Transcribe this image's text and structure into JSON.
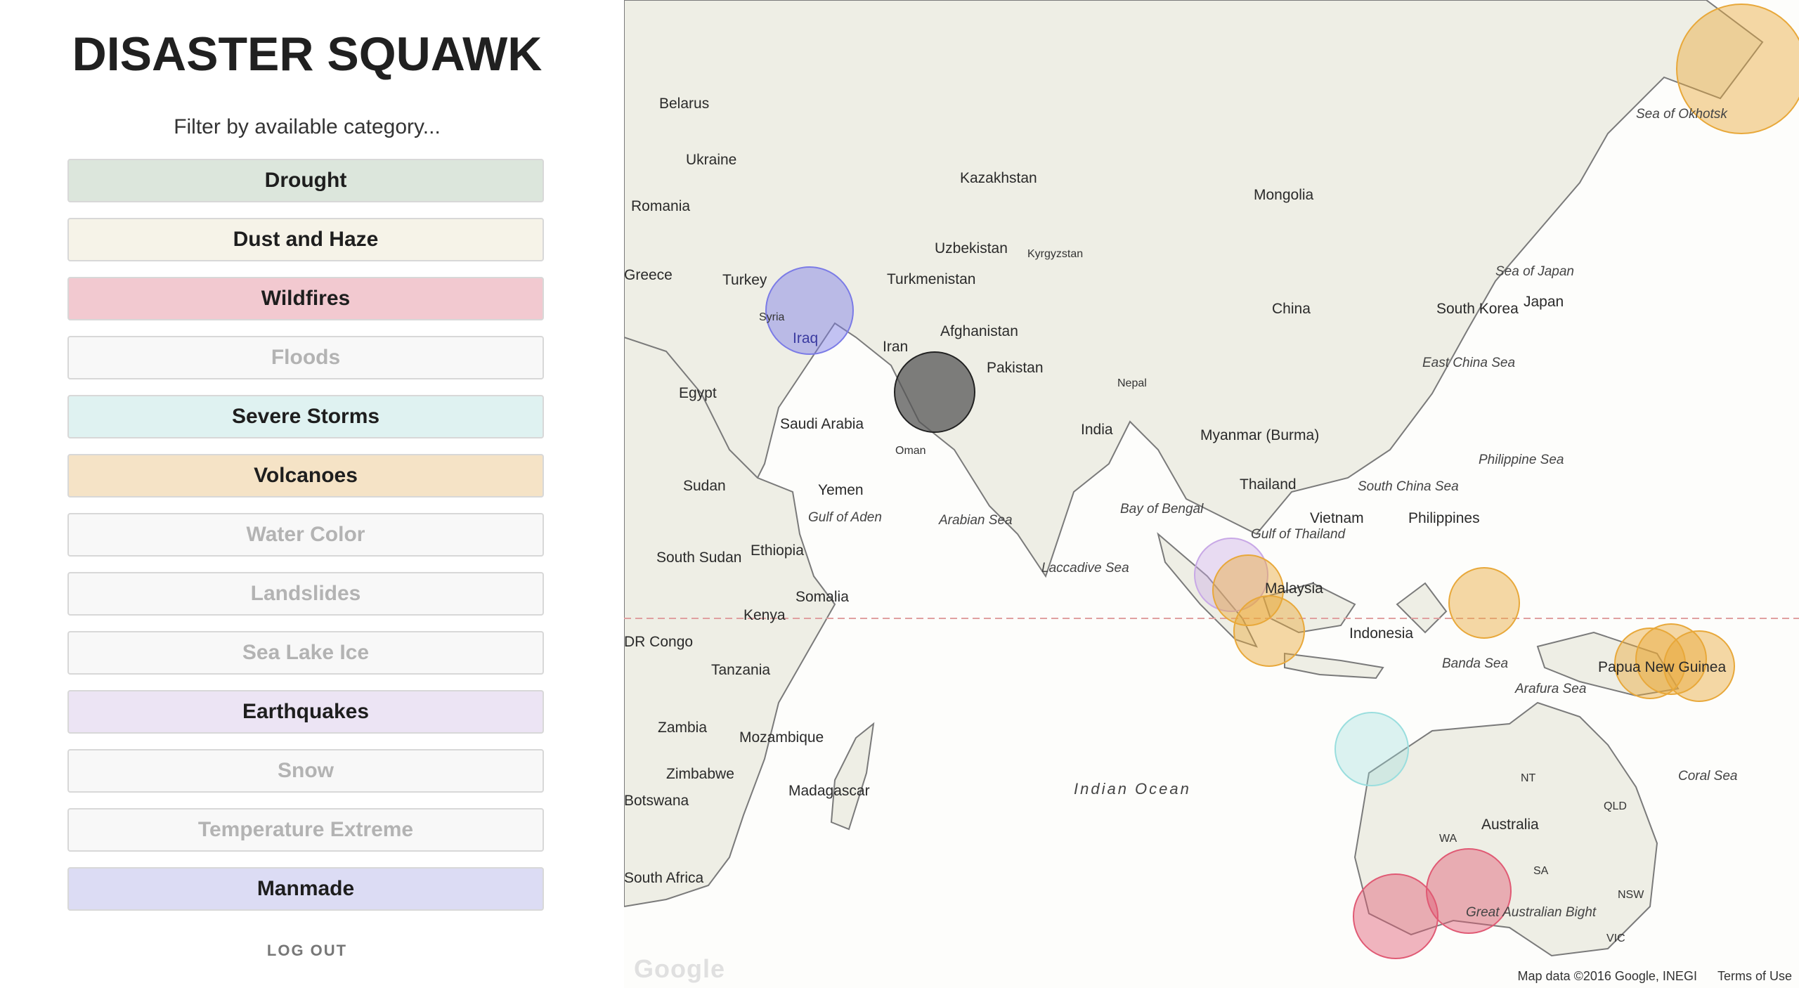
{
  "app": {
    "title": "DISASTER SQUAWK",
    "filter_prompt": "Filter by available category..."
  },
  "categories": [
    {
      "label": "Drought",
      "active": true,
      "color": "#dce6dc"
    },
    {
      "label": "Dust and Haze",
      "active": true,
      "color": "#f6f3e8"
    },
    {
      "label": "Wildfires",
      "active": true,
      "color": "#f2c9d0"
    },
    {
      "label": "Floods",
      "active": false,
      "color": "#f8f8f8"
    },
    {
      "label": "Severe Storms",
      "active": true,
      "color": "#dff2f1"
    },
    {
      "label": "Volcanoes",
      "active": true,
      "color": "#f5e3c6"
    },
    {
      "label": "Water Color",
      "active": false,
      "color": "#f8f8f8"
    },
    {
      "label": "Landslides",
      "active": false,
      "color": "#f8f8f8"
    },
    {
      "label": "Sea Lake Ice",
      "active": false,
      "color": "#f8f8f8"
    },
    {
      "label": "Earthquakes",
      "active": true,
      "color": "#ece4f4"
    },
    {
      "label": "Snow",
      "active": false,
      "color": "#f8f8f8"
    },
    {
      "label": "Temperature Extreme",
      "active": false,
      "color": "#f8f8f8"
    },
    {
      "label": "Manmade",
      "active": true,
      "color": "#dcdcf4"
    }
  ],
  "logout_label": "LOG OUT",
  "map": {
    "countries": [
      "Belarus",
      "Ukraine",
      "Romania",
      "Greece",
      "Turkey",
      "Syria",
      "Iraq",
      "Iran",
      "Egypt",
      "Saudi Arabia",
      "Oman",
      "Yemen",
      "Sudan",
      "South Sudan",
      "Ethiopia",
      "Somalia",
      "Kenya",
      "DR Congo",
      "Tanzania",
      "Zambia",
      "Mozambique",
      "Zimbabwe",
      "Botswana",
      "Madagascar",
      "South Africa",
      "Kazakhstan",
      "Uzbekistan",
      "Kyrgyzstan",
      "Turkmenistan",
      "Afghanistan",
      "Pakistan",
      "India",
      "Nepal",
      "Mongolia",
      "China",
      "South Korea",
      "Japan",
      "Myanmar (Burma)",
      "Thailand",
      "Vietnam",
      "Philippines",
      "Malaysia",
      "Indonesia",
      "Papua New Guinea",
      "Australia",
      "NT",
      "QLD",
      "WA",
      "SA",
      "NSW",
      "VIC"
    ],
    "seas": [
      "Sea of Okhotsk",
      "Sea of Japan",
      "East China Sea",
      "Philippine Sea",
      "South China Sea",
      "Bay of Bengal",
      "Gulf of Thailand",
      "Gulf of Aden",
      "Arabian Sea",
      "Laccadive Sea",
      "Banda Sea",
      "Arafura Sea",
      "Coral Sea",
      "Great Australian Bight",
      "Indian Ocean"
    ],
    "attribution": "Map data ©2016 Google, INEGI",
    "terms": "Terms of Use",
    "logo": "Google",
    "event_colors": {
      "manmade": "#7b7be6",
      "volcano": "#e8a83a",
      "earthquake": "#c8a8e6",
      "wildfire": "#e05a74",
      "storm": "#9adede",
      "dust": "#555555"
    }
  }
}
